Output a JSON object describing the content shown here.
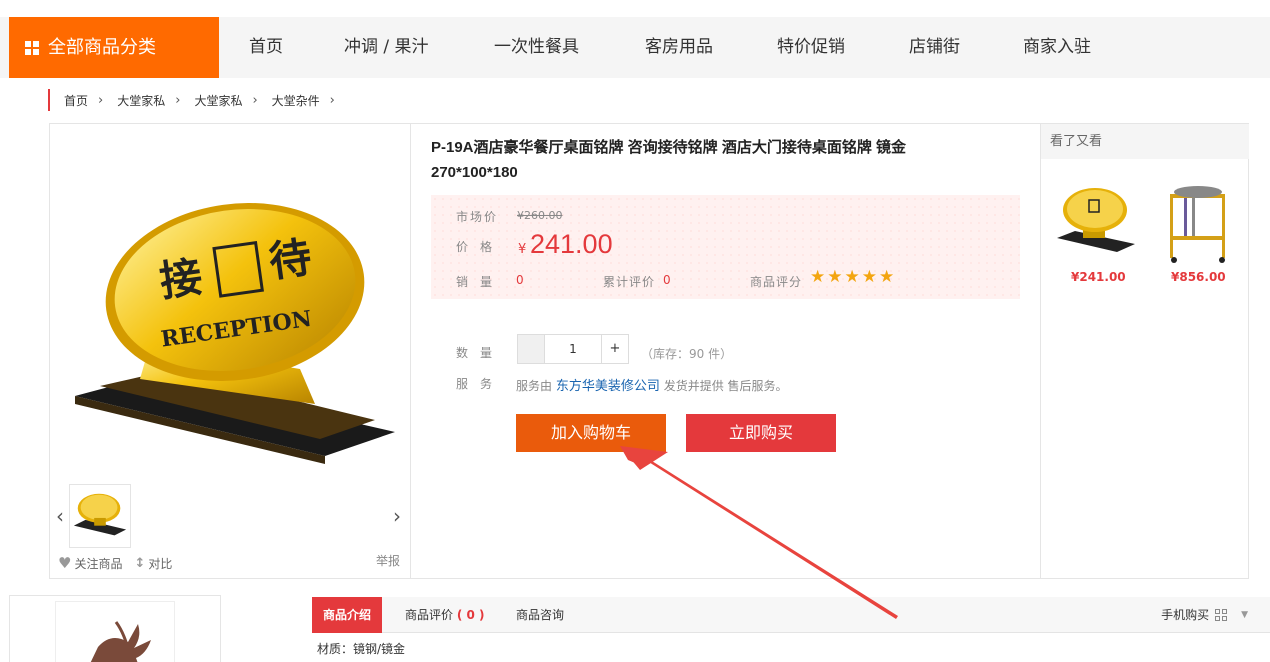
{
  "nav": {
    "all_categories": "全部商品分类",
    "links": [
      "首页",
      "冲调 / 果汁",
      "一次性餐具",
      "客房用品",
      "特价促销",
      "店铺街",
      "商家入驻"
    ]
  },
  "breadcrumb": [
    "首页",
    "大堂家私",
    "大堂家私",
    "大堂杂件"
  ],
  "gallery": {
    "sign_text_1": "接",
    "sign_text_2": "待",
    "sign_text_en": "RECEPTION",
    "prev": "‹",
    "next": "›",
    "follow_label": "关注商品",
    "compare_label": "对比",
    "report_label": "举报"
  },
  "product": {
    "title": "P-19A酒店豪华餐厅桌面铭牌 咨询接待铭牌 酒店大门接待桌面铭牌 镜金 270*100*180",
    "market_price_label": "市场价",
    "market_price": "¥260.00",
    "price_label": "价格",
    "currency": "¥",
    "price": "241.00",
    "sales_label": "销量",
    "sales": "0",
    "reviews_label": "累计评价",
    "reviews": "0",
    "rating_label": "商品评分",
    "rating_stars": 5,
    "qty_label": "数量",
    "qty": "1",
    "qty_plus": "+",
    "stock": "（库存：90 件）",
    "service_label": "服务",
    "service_prefix": "服务由",
    "shop_name": "东方华美装修公司",
    "service_suffix": "发货并提供 售后服务。",
    "add_cart": "加入购物车",
    "buy_now": "立即购买"
  },
  "also_viewed": {
    "heading": "看了又看",
    "items": [
      {
        "price": "¥241.00"
      },
      {
        "price": "¥856.00"
      }
    ]
  },
  "tabs": {
    "intro": "商品介绍",
    "reviews": "商品评价",
    "reviews_count": "( 0 )",
    "consult": "商品咨询",
    "mobile_buy": "手机购买"
  },
  "detail": {
    "material": "材质：镜钢/镜金"
  },
  "colors": {
    "brand_orange": "#ff6a00",
    "cart_orange": "#ea5b0c",
    "buy_red": "#e4393c",
    "star": "#f3a510",
    "shop_link": "#1a65b0"
  }
}
